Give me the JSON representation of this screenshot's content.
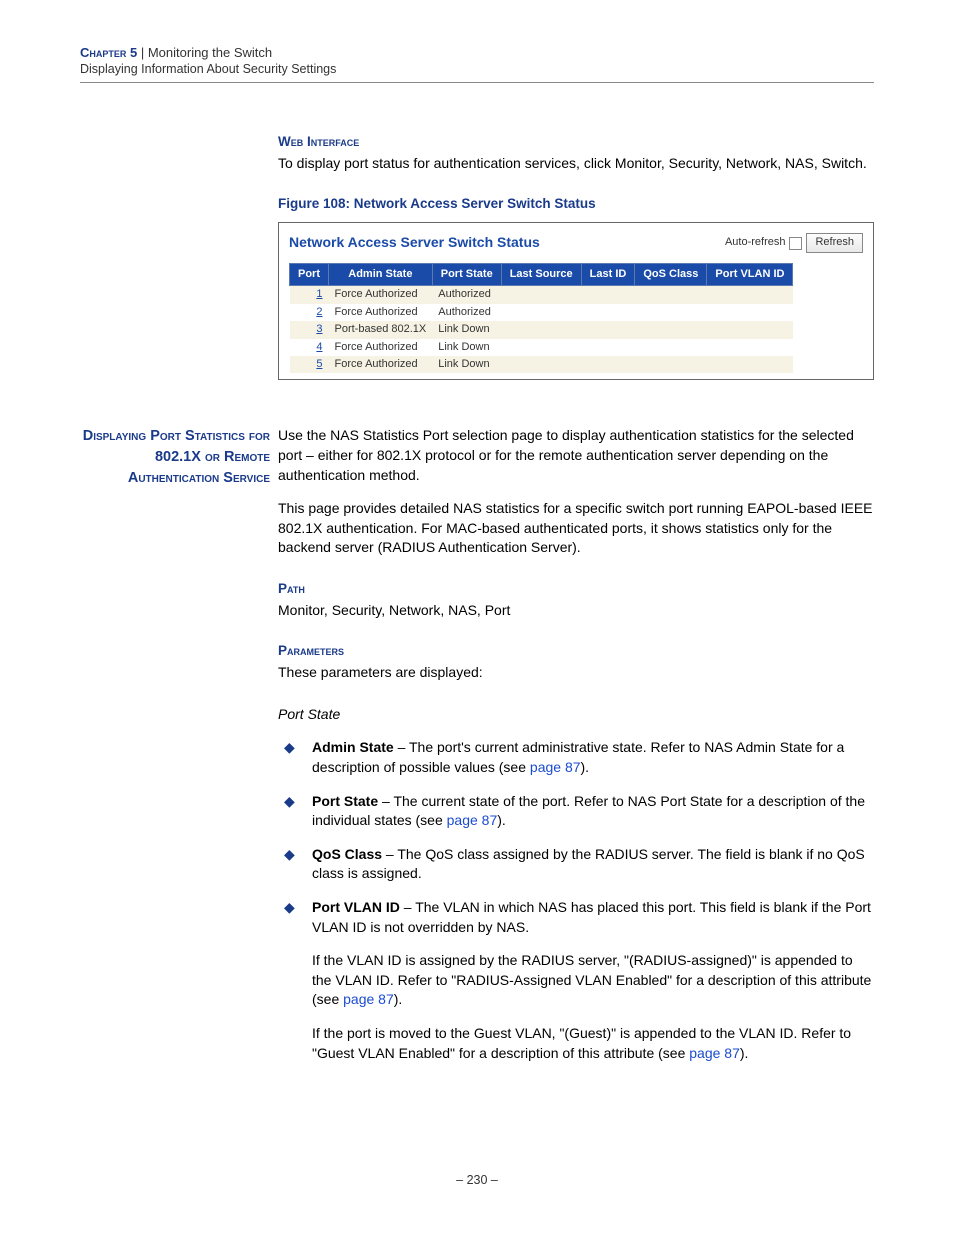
{
  "header": {
    "chapter": "Chapter 5",
    "sep": "  |  ",
    "title": "Monitoring the Switch",
    "subtitle": "Displaying Information About Security Settings"
  },
  "section1": {
    "head": "Web Interface",
    "text": "To display port status for authentication services, click Monitor, Security, Network, NAS, Switch.",
    "figcap": "Figure 108:  Network Access Server Switch Status"
  },
  "screenshot": {
    "title": "Network Access Server Switch Status",
    "auto": "Auto-refresh",
    "refresh": "Refresh",
    "cols": [
      "Port",
      "Admin State",
      "Port State",
      "Last Source",
      "Last ID",
      "QoS Class",
      "Port VLAN ID"
    ],
    "rows": [
      {
        "port": "1",
        "admin": "Force Authorized",
        "state": "Authorized",
        "ls": "",
        "lid": "",
        "qos": "",
        "pvid": ""
      },
      {
        "port": "2",
        "admin": "Force Authorized",
        "state": "Authorized",
        "ls": "",
        "lid": "",
        "qos": "",
        "pvid": ""
      },
      {
        "port": "3",
        "admin": "Port-based 802.1X",
        "state": "Link Down",
        "ls": "",
        "lid": "",
        "qos": "",
        "pvid": ""
      },
      {
        "port": "4",
        "admin": "Force Authorized",
        "state": "Link Down",
        "ls": "",
        "lid": "",
        "qos": "",
        "pvid": ""
      },
      {
        "port": "5",
        "admin": "Force Authorized",
        "state": "Link Down",
        "ls": "",
        "lid": "",
        "qos": "",
        "pvid": ""
      }
    ]
  },
  "section2": {
    "side": "Displaying Port Statistics for 802.1X or Remote Authentication Service",
    "p1": "Use the NAS Statistics Port selection page to display authentication statistics for the selected port – either for 802.1X protocol or for the remote authentication server depending on the authentication method.",
    "p2": "This page provides detailed NAS statistics for a specific switch port running EAPOL-based IEEE 802.1X authentication. For MAC-based authenticated ports, it shows statistics only for the backend server (RADIUS Authentication Server).",
    "path_head": "Path",
    "path_text": "Monitor, Security, Network, NAS, Port",
    "param_head": "Parameters",
    "param_text": "These parameters are displayed:",
    "substate": "Port State"
  },
  "bullets": {
    "b1_term": "Admin State",
    "b1_rest": " – The port's current administrative state. Refer to NAS Admin State for a description of possible values (see ",
    "b1_link": "page 87",
    "b1_end": ").",
    "b2_term": "Port State",
    "b2_rest": " – The current state of the port. Refer to NAS Port State for a description of the individual states (see ",
    "b2_link": "page 87",
    "b2_end": ").",
    "b3_term": "QoS Class",
    "b3_rest": " – The QoS class assigned by the RADIUS server. The field is blank if no QoS class is assigned.",
    "b4_term": "Port VLAN ID",
    "b4_rest": " – The VLAN in which NAS has placed this port. This field is blank if the Port VLAN ID is not overridden by NAS.",
    "b4_p2a": "If the VLAN ID is assigned by the RADIUS server, \"(RADIUS-assigned)\" is appended to the VLAN ID. Refer to \"RADIUS-Assigned VLAN Enabled\" for a description of this attribute (see ",
    "b4_p2link": "page 87",
    "b4_p2b": ").",
    "b4_p3a": "If the port is moved to the Guest VLAN, \"(Guest)\" is appended to the VLAN ID. Refer to \"Guest VLAN Enabled\" for a description of this attribute (see ",
    "b4_p3link": "page 87",
    "b4_p3b": ")."
  },
  "footer": "– 230 –"
}
